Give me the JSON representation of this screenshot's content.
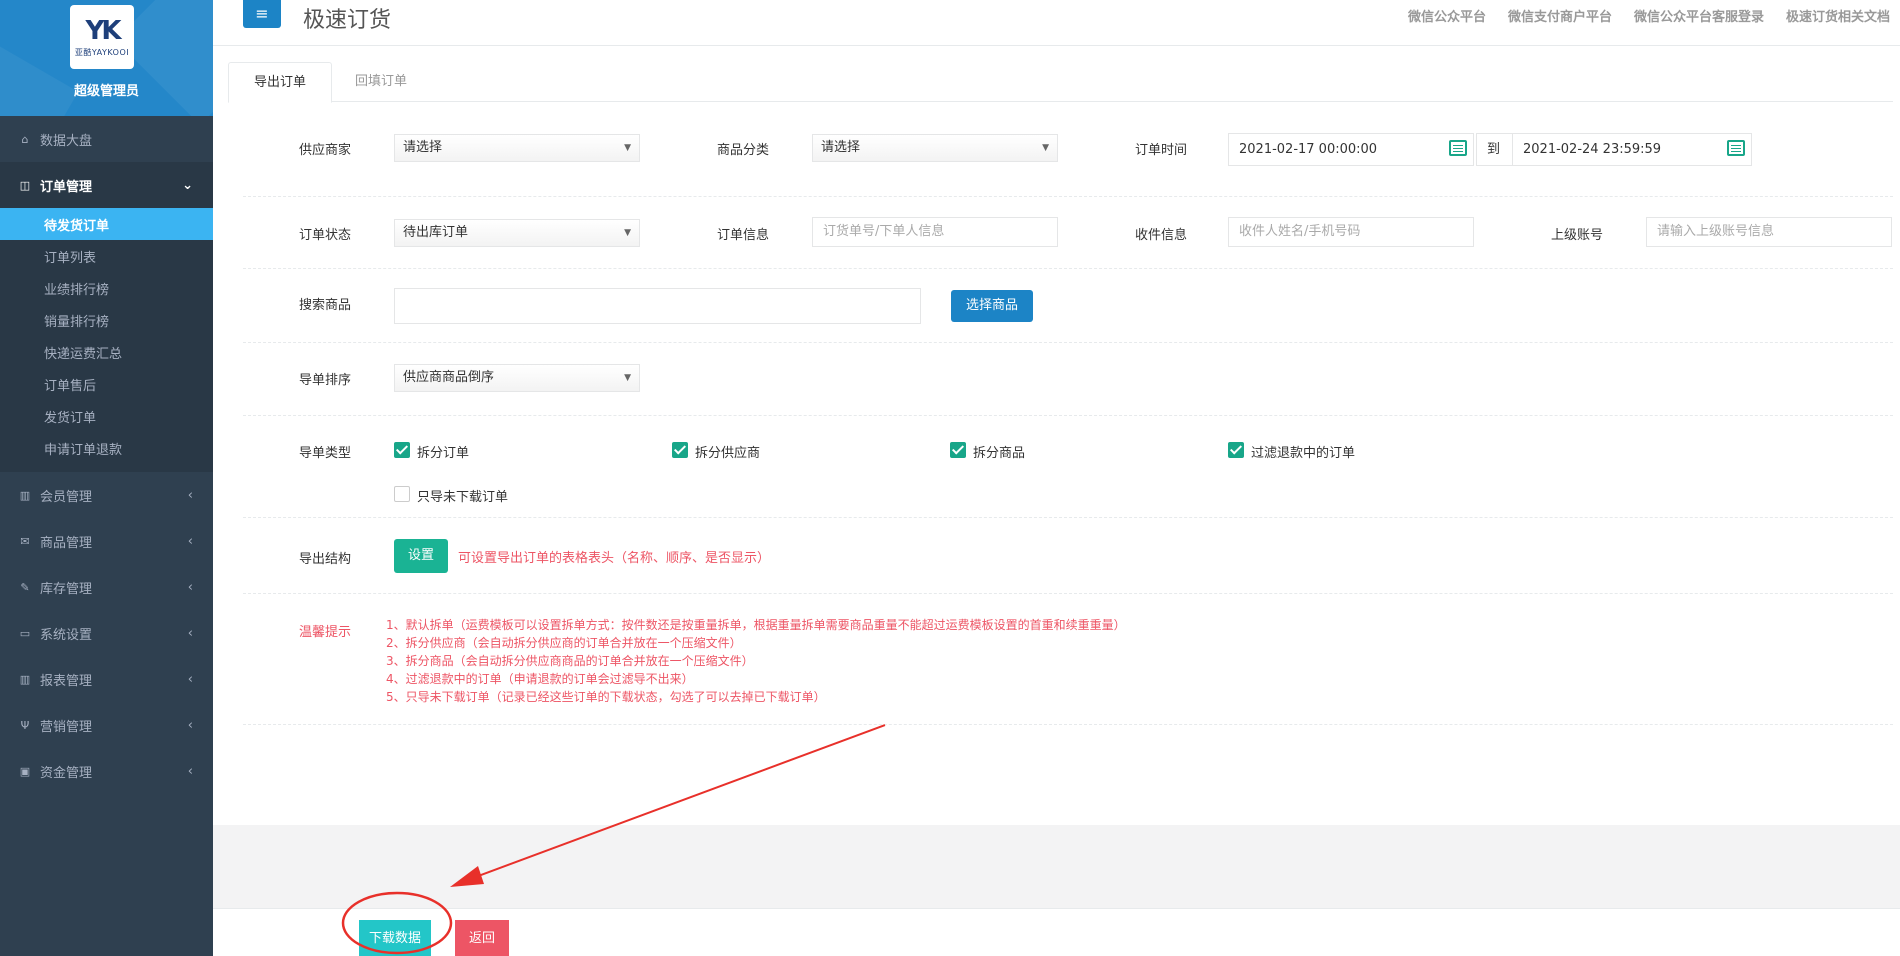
{
  "sidebar": {
    "logo_mark": "YK",
    "logo_text": "亚酷YAYKOOI",
    "admin_name": "超级管理员",
    "items": [
      {
        "label": "数据大盘",
        "icon": "home-icon"
      },
      {
        "label": "订单管理",
        "icon": "columns-icon"
      },
      {
        "label": "会员管理",
        "icon": "bar-chart-icon"
      },
      {
        "label": "商品管理",
        "icon": "envelope-icon"
      },
      {
        "label": "库存管理",
        "icon": "edit-icon"
      },
      {
        "label": "系统设置",
        "icon": "desktop-icon"
      },
      {
        "label": "报表管理",
        "icon": "bar-chart-icon"
      },
      {
        "label": "营销管理",
        "icon": "cutlery-icon"
      },
      {
        "label": "资金管理",
        "icon": "money-icon"
      }
    ],
    "sub_items": [
      "待发货订单",
      "订单列表",
      "业绩排行榜",
      "销量排行榜",
      "快递运费汇总",
      "订单售后",
      "发货订单",
      "申请订单退款"
    ]
  },
  "topbar": {
    "menu_icon": "≡",
    "title": "极速订货",
    "links": [
      "微信公众平台",
      "微信支付商户平台",
      "微信公众平台客服登录",
      "极速订货相关文档"
    ]
  },
  "tabs": [
    "导出订单",
    "回填订单"
  ],
  "form": {
    "supplier_label": "供应商家",
    "supplier_value": "请选择",
    "category_label": "商品分类",
    "category_value": "请选择",
    "time_label": "订单时间",
    "time_start": "2021-02-17 00:00:00",
    "time_to": "到",
    "time_end": "2021-02-24 23:59:59",
    "status_label": "订单状态",
    "status_value": "待出库订单",
    "info_label": "订单信息",
    "info_placeholder": "订货单号/下单人信息",
    "receiver_label": "收件信息",
    "receiver_placeholder": "收件人姓名/手机号码",
    "parent_label": "上级账号",
    "parent_placeholder": "请输入上级账号信息",
    "search_label": "搜索商品",
    "search_value": "",
    "select_goods_btn": "选择商品",
    "sort_label": "导单排序",
    "sort_value": "供应商商品倒序",
    "type_label": "导单类型",
    "checkboxes": [
      {
        "label": "拆分订单",
        "checked": true
      },
      {
        "label": "拆分供应商",
        "checked": true
      },
      {
        "label": "拆分商品",
        "checked": true
      },
      {
        "label": "过滤退款中的订单",
        "checked": true
      },
      {
        "label": "只导未下载订单",
        "checked": false
      }
    ],
    "structure_label": "导出结构",
    "settings_btn": "设置",
    "structure_hint": "可设置导出订单的表格表头（名称、顺序、是否显示）",
    "tips_label": "温馨提示",
    "tips": [
      "1、默认拆单（运费模板可以设置拆单方式：按件数还是按重量拆单，根据重量拆单需要商品重量不能超过运费模板设置的首重和续重重量）",
      "2、拆分供应商（会自动拆分供应商的订单合并放在一个压缩文件）",
      "3、拆分商品（会自动拆分供应商商品的订单合并放在一个压缩文件）",
      "4、过滤退款中的订单（申请退款的订单会过滤导不出来）",
      "5、只导未下载订单（记录已经这些订单的下载状态，勾选了可以去掉已下载订单）"
    ]
  },
  "bottom": {
    "download_btn": "下载数据",
    "back_btn": "返回"
  },
  "colors": {
    "sidebar_bg": "#2f4050",
    "header_blue": "#2487c9",
    "active_sub": "#3bb4f2",
    "primary": "#1c84c6",
    "green": "#1ab394",
    "danger": "#ed5565",
    "annotation_red": "#e8302a"
  }
}
